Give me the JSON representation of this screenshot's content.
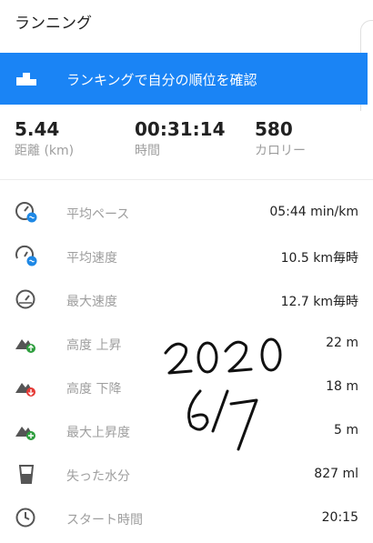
{
  "header": {
    "title": "ランニング"
  },
  "rank_banner": {
    "label": "ランキングで自分の順位を確認",
    "icon": "podium-icon",
    "color": "#1a84f5"
  },
  "summary": [
    {
      "value": "5.44",
      "label": "距離 (km)"
    },
    {
      "value": "00:31:14",
      "label": "時間"
    },
    {
      "value": "580",
      "label": "カロリー"
    }
  ],
  "stats": [
    {
      "icon": "pace-gauge-icon",
      "label": "平均ペース",
      "value": "05:44 min/km"
    },
    {
      "icon": "speed-gauge-icon",
      "label": "平均速度",
      "value": "10.5 km毎時"
    },
    {
      "icon": "speedometer-icon",
      "label": "最大速度",
      "value": "12.7 km毎時"
    },
    {
      "icon": "elevation-up-icon",
      "label": "高度 上昇",
      "value": "22 m"
    },
    {
      "icon": "elevation-down-icon",
      "label": "高度 下降",
      "value": "18 m"
    },
    {
      "icon": "max-elevation-icon",
      "label": "最大上昇度",
      "value": "5 m"
    },
    {
      "icon": "water-glass-icon",
      "label": "失った水分",
      "value": "827 ml"
    },
    {
      "icon": "clock-icon",
      "label": "スタート時間",
      "value": "20:15"
    }
  ],
  "handwriting": {
    "line1": "2020",
    "line2": "6/7"
  }
}
